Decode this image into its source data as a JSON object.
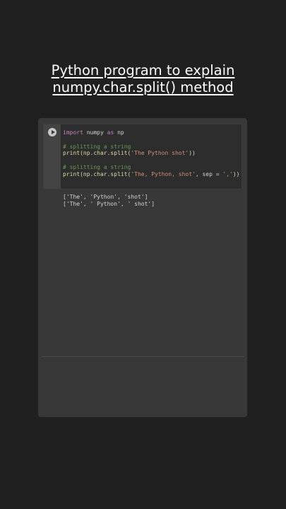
{
  "title": {
    "line1": "Python program to explain",
    "line2": "numpy.char.split() method"
  },
  "icons": {
    "run": "play-circle-icon"
  },
  "code": {
    "line1_kw1": "import",
    "line1_mid": " numpy ",
    "line1_kw2": "as",
    "line1_end": " np",
    "line3_comment": "# splitting a string",
    "line4_pre": "print(np.char.split(",
    "line4_str": "'The Python shot'",
    "line4_post": "))",
    "line6_comment": "# splitting a string",
    "line7_pre": "print(np.char.split(",
    "line7_str1": "'The, Python, shot'",
    "line7_mid": ", sep = ",
    "line7_str2": "','",
    "line7_post": "))"
  },
  "output": {
    "line1": "['The', 'Python', 'shot']",
    "line2": "['The', ' Python', ' shot']"
  }
}
